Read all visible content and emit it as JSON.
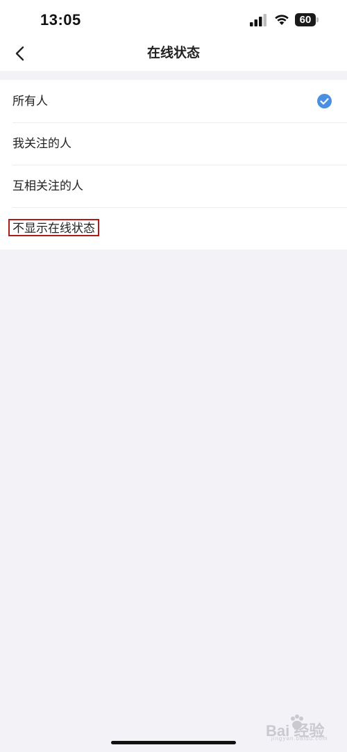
{
  "status_bar": {
    "time": "13:05",
    "battery_level": "60",
    "icons": [
      "signal-icon",
      "wifi-icon",
      "battery-icon"
    ]
  },
  "nav": {
    "title": "在线状态",
    "back_icon": "chevron-left-icon"
  },
  "options": [
    {
      "label": "所有人",
      "selected": true
    },
    {
      "label": "我关注的人",
      "selected": false
    },
    {
      "label": "互相关注的人",
      "selected": false
    },
    {
      "label": "不显示在线状态",
      "selected": false,
      "highlighted": true
    }
  ],
  "colors": {
    "accent": "#4a90e2",
    "highlight_border": "#b01a1a",
    "background": "#f2f2f7"
  },
  "watermark": {
    "text": "Bai 经验",
    "sub": "jingyan.baidu.com"
  }
}
